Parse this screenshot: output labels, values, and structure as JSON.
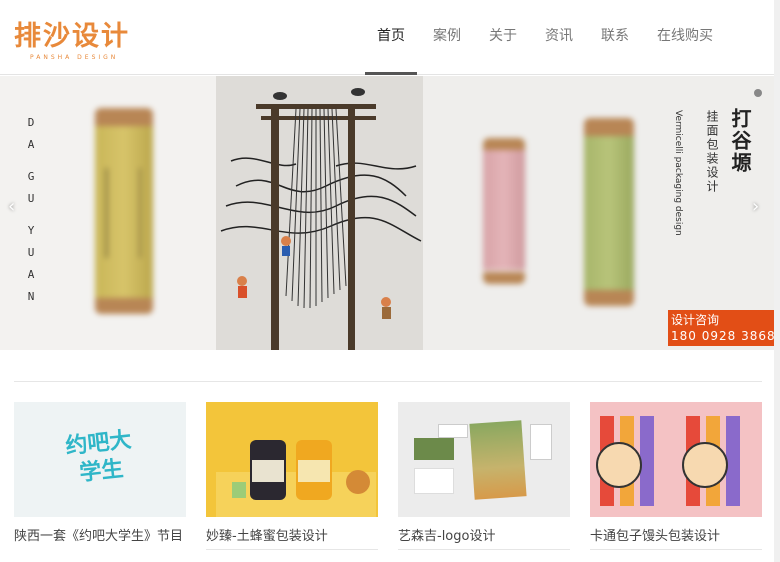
{
  "header": {
    "logo": "排沙设计",
    "logo_sub": "PANSHA DESIGN",
    "nav": [
      "首页",
      "案例",
      "关于",
      "资讯",
      "联系",
      "在线购买"
    ]
  },
  "banner": {
    "vertical_letters": [
      "D",
      "A",
      "G",
      "U",
      "Y",
      "U",
      "A",
      "N"
    ],
    "title": "打谷塬",
    "subtitle": "挂面包装设计",
    "english": "Vermicelli packaging design",
    "consult_label": "设计咨询",
    "consult_phone": "180 0928 3868",
    "prev_arrow": "‹",
    "next_arrow": "›"
  },
  "cases": [
    {
      "title": "陕西一套《约吧大学生》节目",
      "logo_text": "约吧大学生"
    },
    {
      "title": "妙臻-土蜂蜜包装设计"
    },
    {
      "title": "艺森吉-logo设计"
    },
    {
      "title": "卡通包子馒头包装设计"
    }
  ],
  "colors": {
    "brand": "#e8893a",
    "consult": "#e24e16"
  }
}
